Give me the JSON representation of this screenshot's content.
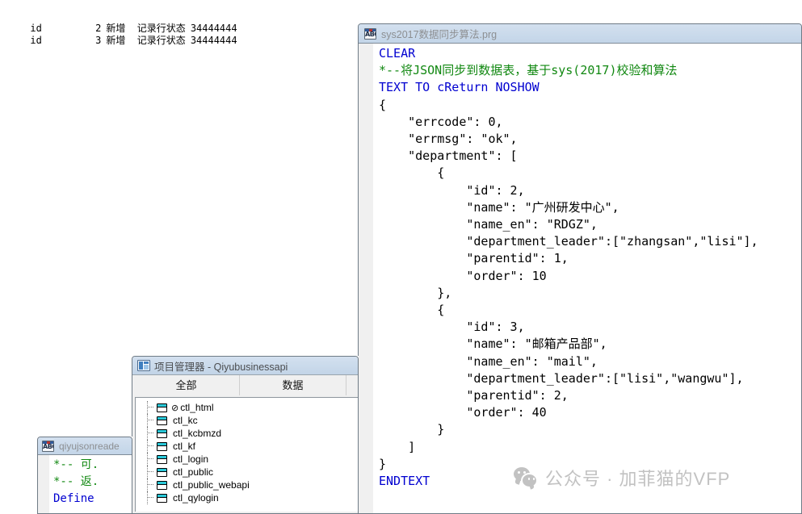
{
  "output_panel": {
    "name": "command-output",
    "lines": [
      {
        "id": "id",
        "num": "2",
        "cn": "新增  记录行状态",
        "tail": "34444444"
      },
      {
        "id": "id",
        "num": "3",
        "cn": "新增  记录行状态",
        "tail": "34444444"
      }
    ]
  },
  "main_window": {
    "title": "sys2017数据同步算法.prg",
    "icon": "abc-text-file-icon",
    "code_lines": [
      {
        "kind": "kw",
        "text": "CLEAR"
      },
      {
        "kind": "cm",
        "text": "*--将JSON同步到数据表，基于sys(2017)校验和算法"
      },
      {
        "kind": "kw",
        "text": "TEXT TO cReturn NOSHOW"
      },
      {
        "kind": "plain",
        "text": "{"
      },
      {
        "kind": "plain",
        "text": "    \"errcode\": 0,"
      },
      {
        "kind": "plain",
        "text": "    \"errmsg\": \"ok\","
      },
      {
        "kind": "plain",
        "text": "    \"department\": ["
      },
      {
        "kind": "plain",
        "text": "        {"
      },
      {
        "kind": "plain",
        "text": "            \"id\": 2,"
      },
      {
        "kind": "plain",
        "text": "            \"name\": \"广州研发中心\","
      },
      {
        "kind": "plain",
        "text": "            \"name_en\": \"RDGZ\","
      },
      {
        "kind": "plain",
        "text": "            \"department_leader\":[\"zhangsan\",\"lisi\"],"
      },
      {
        "kind": "plain",
        "text": "            \"parentid\": 1,"
      },
      {
        "kind": "plain",
        "text": "            \"order\": 10"
      },
      {
        "kind": "plain",
        "text": "        },"
      },
      {
        "kind": "plain",
        "text": "        {"
      },
      {
        "kind": "plain",
        "text": "            \"id\": 3,"
      },
      {
        "kind": "plain",
        "text": "            \"name\": \"邮箱产品部\","
      },
      {
        "kind": "plain",
        "text": "            \"name_en\": \"mail\","
      },
      {
        "kind": "plain",
        "text": "            \"department_leader\":[\"lisi\",\"wangwu\"],"
      },
      {
        "kind": "plain",
        "text": "            \"parentid\": 2,"
      },
      {
        "kind": "plain",
        "text": "            \"order\": 40"
      },
      {
        "kind": "plain",
        "text": "        }"
      },
      {
        "kind": "plain",
        "text": "    ]"
      },
      {
        "kind": "plain",
        "text": "}"
      },
      {
        "kind": "kw",
        "text": "ENDTEXT"
      }
    ]
  },
  "small_window": {
    "title": "qiyujsonreade",
    "icon": "abc-text-file-icon",
    "code_lines": [
      {
        "kind": "cm",
        "text": "*-- 可."
      },
      {
        "kind": "cm",
        "text": "*-- 返."
      },
      {
        "kind": "kw",
        "text": "Define"
      }
    ]
  },
  "project_manager": {
    "title": "项目管理器 - Qiyubusinessapi",
    "icon": "project-manager-icon",
    "tabs": [
      {
        "label": "全部"
      },
      {
        "label": "数据"
      },
      {
        "label": ""
      }
    ],
    "items": [
      {
        "mark": "⊘",
        "label": "ctl_html"
      },
      {
        "mark": "",
        "label": "ctl_kc"
      },
      {
        "mark": "",
        "label": "ctl_kcbmzd"
      },
      {
        "mark": "",
        "label": "ctl_kf"
      },
      {
        "mark": "",
        "label": "ctl_login"
      },
      {
        "mark": "",
        "label": "ctl_public"
      },
      {
        "mark": "",
        "label": "ctl_public_webapi"
      },
      {
        "mark": "",
        "label": "ctl_qylogin"
      }
    ]
  },
  "watermark": {
    "icon": "wechat-icon",
    "text": "公众号 · 加菲猫的VFP"
  },
  "colors": {
    "keyword": "#0000d0",
    "comment": "#118811",
    "titlebar": "#cadaeb",
    "window_border": "#6f7b86",
    "watermark": "#c2c2c2",
    "tree_icon": "#29c8d8"
  }
}
